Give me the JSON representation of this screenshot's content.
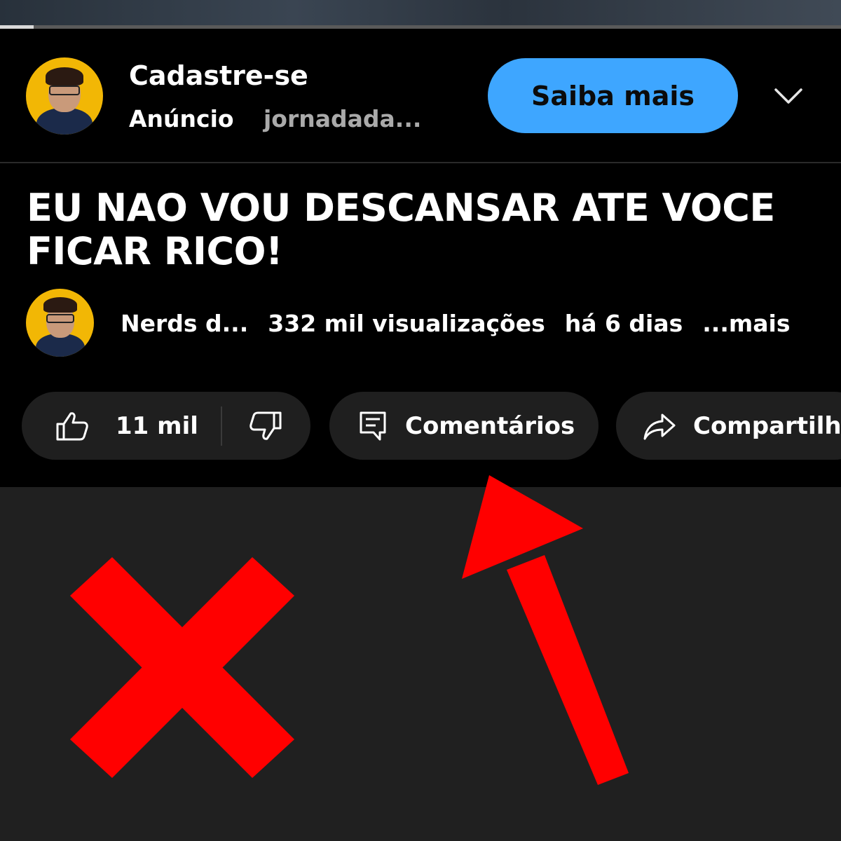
{
  "player": {
    "progress_fraction": 0.04
  },
  "ad": {
    "title": "Cadastre-se",
    "label": "Anúncio",
    "url": "jornadada...",
    "cta_label": "Saiba mais",
    "cta_color": "#3ea6ff",
    "menu_icon": "chevron-down-icon"
  },
  "video": {
    "title": "EU NAO VOU DESCANSAR ATE VOCE FICAR RICO!",
    "channel": "Nerds d...",
    "views": "332 mil visualizações",
    "age": "há 6 dias",
    "more": "...mais"
  },
  "actions": {
    "likes": "11 mil",
    "comments_label": "Comentários",
    "share_label": "Compartilh"
  },
  "annotations": {
    "color": "#ff0000",
    "x_icon": "red-x-mark",
    "arrow_icon": "red-arrow-pointing-to-comments"
  }
}
